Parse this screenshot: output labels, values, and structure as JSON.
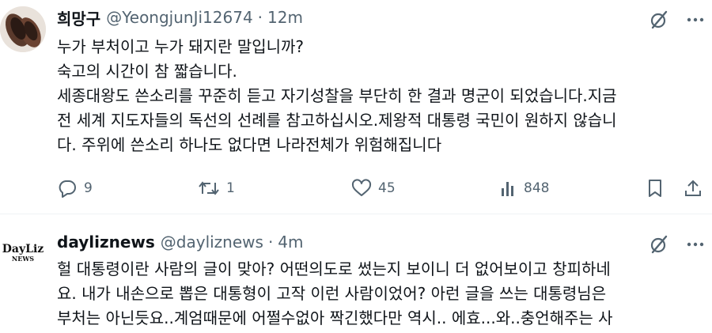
{
  "tweets": [
    {
      "name": "희망구",
      "handle": "@YeongjunJi12674",
      "separator": "·",
      "time": "12m",
      "lines": [
        "누가 부처이고 누가 돼지란 말입니까?",
        "숙고의 시간이 참 짧습니다.",
        "세종대왕도 쓴소리를 꾸준히 듣고 자기성찰을 부단히 한 결과 명군이 되었습니다.지금",
        "전 세계 지도자들의 독선의 선례를 참고하십시오.제왕적 대통령 국민이 원하지 않습니",
        "다. 주위에 쓴소리 하나도 없다면 나라전체가 위험해집니다"
      ],
      "actions": {
        "reply_count": "9",
        "retweet_count": "1",
        "like_count": "45",
        "view_count": "848"
      }
    },
    {
      "name": "dayliznews",
      "handle": "@dayliznews",
      "separator": "·",
      "time": "4m",
      "avatar_text": "DayLiz",
      "avatar_subtext": "NEWS",
      "lines": [
        "헐 대통령이란 사람의 글이 맞아? 어떤의도로 썼는지 보이니 더 없어보이고 창피하네",
        "요. 내가 내손으로 뽑은 대통형이 고작 이런 사람이었어? 아런 글을 쓰는 대통령님은",
        "부처는 아닌듯요..계엄때문에 어쩔수없아 짝긴했다만 역시.. 에효...와..충언해주는 사"
      ]
    }
  ],
  "colors": {
    "text": "#0f1419",
    "secondary": "#536471",
    "divider": "#eff3f4"
  },
  "icons": [
    "grok-icon",
    "more-icon",
    "reply-icon",
    "retweet-icon",
    "like-icon",
    "views-icon",
    "bookmark-icon",
    "share-icon"
  ]
}
